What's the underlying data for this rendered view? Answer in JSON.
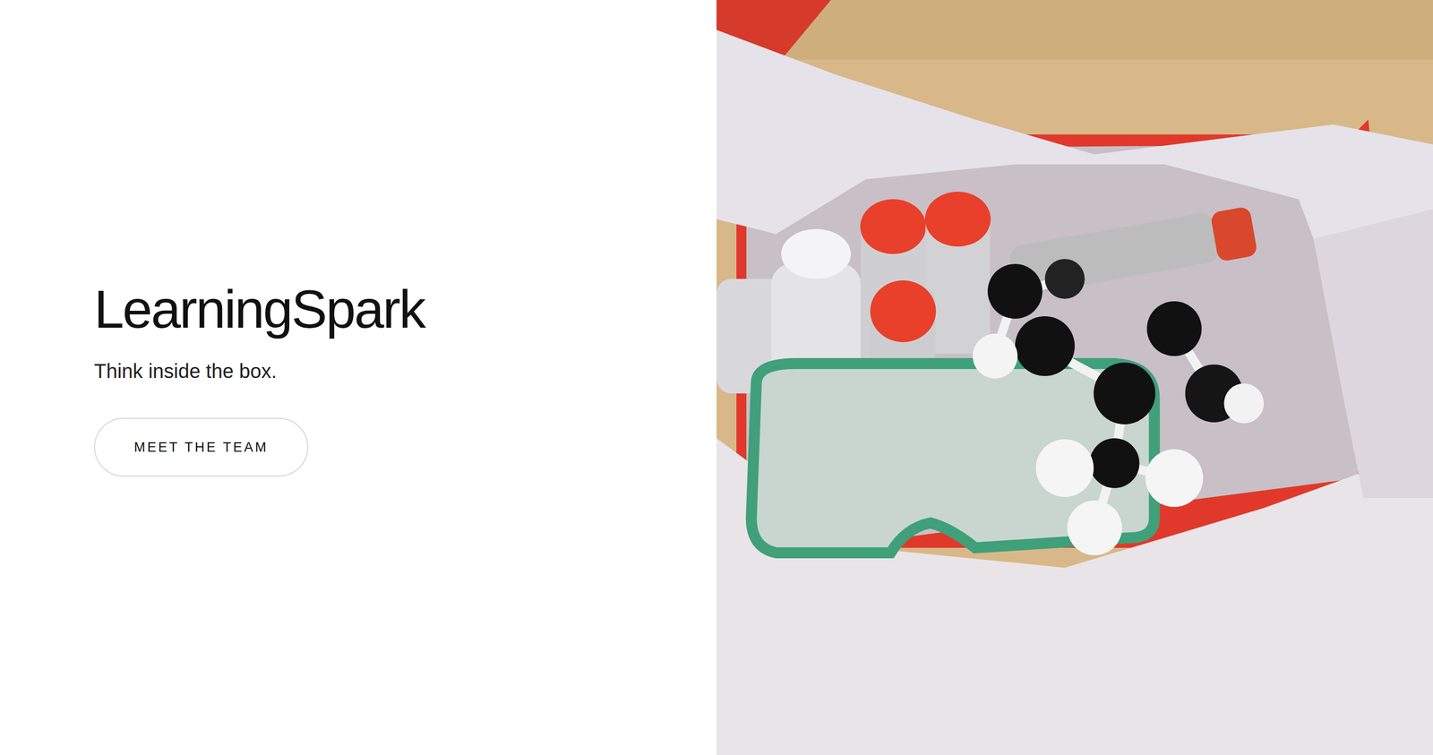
{
  "hero": {
    "title": "LearningSpark",
    "tagline": "Think inside the box.",
    "button": "MEET THE TEAM"
  }
}
